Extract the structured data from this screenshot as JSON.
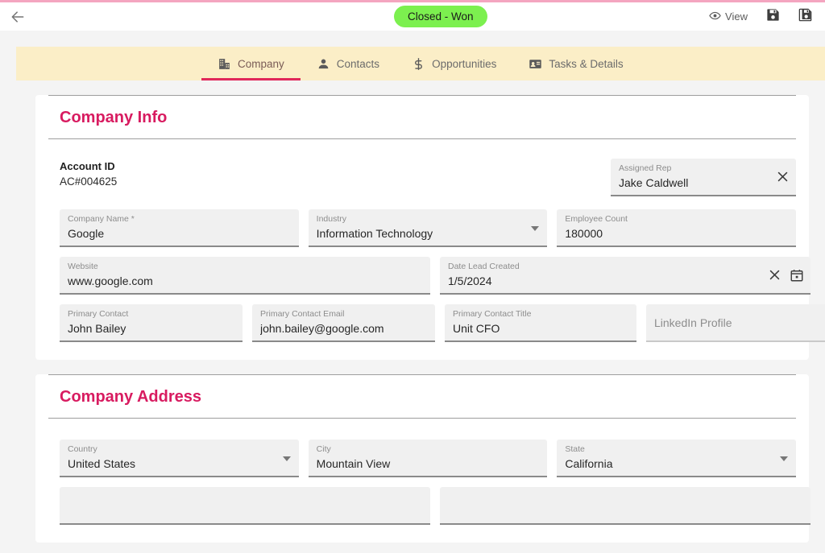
{
  "header": {
    "back_icon": "arrow-left-icon",
    "status_badge": "Closed - Won",
    "status_badge_color": "#7cf04f",
    "view_label": "View",
    "view_icon": "eye-icon",
    "save_icon": "save-icon",
    "save_as_icon": "save-as-icon"
  },
  "tabs": [
    {
      "label": "Company",
      "icon": "building-icon",
      "active": true
    },
    {
      "label": "Contacts",
      "icon": "person-icon",
      "active": false
    },
    {
      "label": "Opportunities",
      "icon": "dollar-icon",
      "active": false
    },
    {
      "label": "Tasks & Details",
      "icon": "contact-card-icon",
      "active": false
    }
  ],
  "theme": {
    "accent": "#d81b60",
    "tab_underline": "#e0285a",
    "tabbar_bg": "#fbeec7",
    "page_bg": "#f4f4f4",
    "field_bg": "#f0f0f0"
  },
  "company_info": {
    "title": "Company Info",
    "account_id_label": "Account ID",
    "account_id_value": "AC#004625",
    "assigned_rep": {
      "label": "Assigned Rep",
      "value": "Jake Caldwell",
      "clear_icon": "close-icon"
    },
    "fields": {
      "company_name": {
        "label": "Company Name *",
        "value": "Google"
      },
      "industry": {
        "label": "Industry",
        "value": "Information Technology",
        "dropdown": true
      },
      "employee_count": {
        "label": "Employee Count",
        "value": "180000"
      },
      "website": {
        "label": "Website",
        "value": "www.google.com"
      },
      "date_lead_created": {
        "label": "Date Lead Created",
        "value": "1/5/2024",
        "clear_icon": "close-icon",
        "calendar_icon": "calendar-icon"
      },
      "primary_contact": {
        "label": "Primary Contact",
        "value": "John Bailey"
      },
      "primary_contact_email": {
        "label": "Primary Contact Email",
        "value": "john.bailey@google.com"
      },
      "primary_contact_title": {
        "label": "Primary Contact Title",
        "value": "Unit CFO"
      },
      "linkedin_profile": {
        "label": "",
        "placeholder": "LinkedIn Profile",
        "value": ""
      }
    }
  },
  "company_address": {
    "title": "Company Address",
    "fields": {
      "country": {
        "label": "Country",
        "value": "United States",
        "dropdown": true
      },
      "city": {
        "label": "City",
        "value": "Mountain View"
      },
      "state": {
        "label": "State",
        "value": "California",
        "dropdown": true
      }
    }
  }
}
